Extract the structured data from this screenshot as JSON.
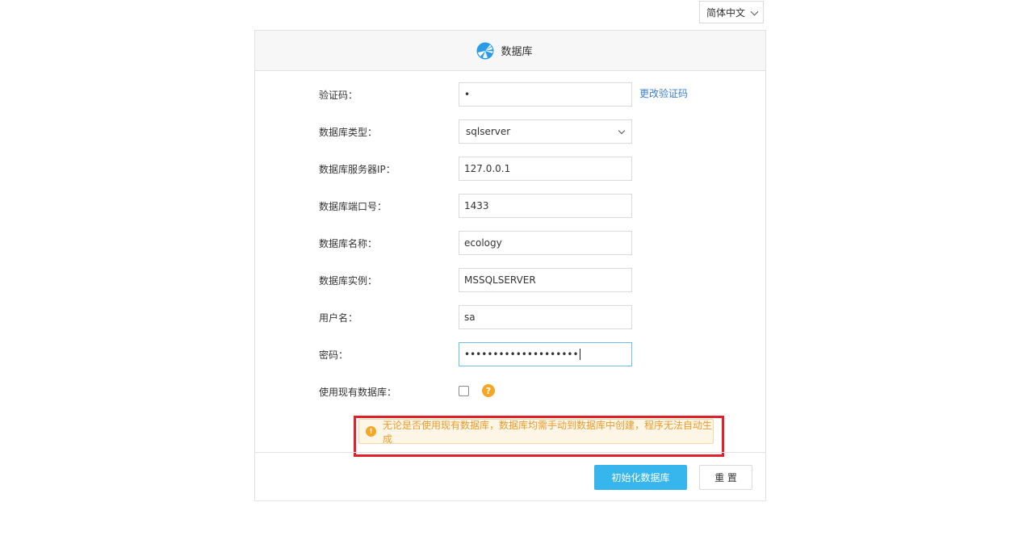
{
  "language": {
    "selected": "简体中文",
    "icon": "chevron-down-icon"
  },
  "panel": {
    "title": "数据库",
    "icon": "database-logo-icon"
  },
  "form": {
    "captcha": {
      "label": "验证码：",
      "value": "•",
      "link": "更改验证码"
    },
    "db_type": {
      "label": "数据库类型：",
      "value": "sqlserver"
    },
    "server_ip": {
      "label": "数据库服务器IP：",
      "value": "127.0.0.1"
    },
    "port": {
      "label": "数据库端口号：",
      "value": "1433"
    },
    "db_name": {
      "label": "数据库名称：",
      "value": "ecology"
    },
    "instance": {
      "label": "数据库实例：",
      "value": "MSSQLSERVER"
    },
    "username": {
      "label": "用户名：",
      "value": "sa"
    },
    "password": {
      "label": "密码：",
      "value": "••••••••••••••••••••"
    },
    "use_existing": {
      "label": "使用现有数据库：",
      "checked": false,
      "help": "?"
    }
  },
  "warning": {
    "icon": "!",
    "text": "无论是否使用现有数据库，数据库均需手动到数据库中创建，程序无法自动生成",
    "color": "#ec9a2b"
  },
  "buttons": {
    "init": "初始化数据库",
    "reset": "重 置"
  },
  "colors": {
    "primary": "#36b6ec",
    "link": "#3a7fd5",
    "highlight": "#e0202a",
    "warning_icon": "#f5a623"
  }
}
